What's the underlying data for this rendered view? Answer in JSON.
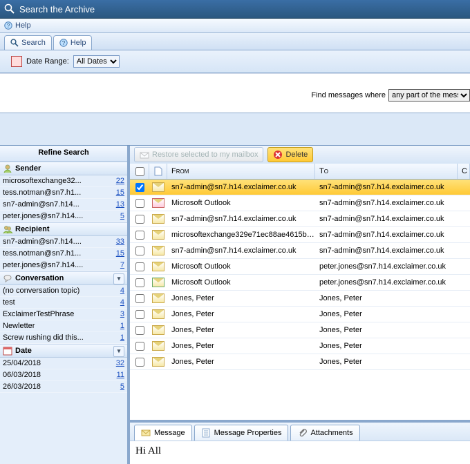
{
  "window": {
    "title": "Search the Archive"
  },
  "menu": {
    "help": "Help"
  },
  "tabs": {
    "search": "Search",
    "help": "Help"
  },
  "dateRange": {
    "label": "Date Range:",
    "options": [
      "All Dates"
    ],
    "selected": "All Dates"
  },
  "find": {
    "label": "Find messages where",
    "options": [
      "any part of the message"
    ],
    "selected": "any part of the message"
  },
  "sidebar": {
    "title": "Refine Search",
    "sections": [
      {
        "name": "Sender",
        "items": [
          {
            "label": "microsoftexchange32...",
            "count": 22
          },
          {
            "label": "tess.notman@sn7.h1...",
            "count": 15
          },
          {
            "label": "sn7-admin@sn7.h14...",
            "count": 13
          },
          {
            "label": "peter.jones@sn7.h14....",
            "count": 5
          }
        ]
      },
      {
        "name": "Recipient",
        "items": [
          {
            "label": "sn7-admin@sn7.h14....",
            "count": 33
          },
          {
            "label": "tess.notman@sn7.h1...",
            "count": 15
          },
          {
            "label": "peter.jones@sn7.h14....",
            "count": 7
          }
        ]
      },
      {
        "name": "Conversation",
        "chevron": true,
        "items": [
          {
            "label": "(no conversation topic)",
            "count": 4
          },
          {
            "label": "test",
            "count": 4
          },
          {
            "label": "ExclaimerTestPhrase",
            "count": 3
          },
          {
            "label": "Newletter",
            "count": 1
          },
          {
            "label": "Screw rushing did this...",
            "count": 1
          }
        ]
      },
      {
        "name": "Date",
        "chevron": true,
        "items": [
          {
            "label": "25/04/2018",
            "count": 32
          },
          {
            "label": "06/03/2018",
            "count": 11
          },
          {
            "label": "26/03/2018",
            "count": 5
          }
        ]
      }
    ]
  },
  "toolbar": {
    "restore": "Restore selected to my mailbox",
    "delete": "Delete"
  },
  "grid": {
    "headers": {
      "from": "From",
      "to": "To",
      "cc": "C"
    },
    "rows": [
      {
        "checked": true,
        "icon": "env",
        "from": "sn7-admin@sn7.h14.exclaimer.co.uk",
        "to": "sn7-admin@sn7.h14.exclaimer.co.uk",
        "selected": true
      },
      {
        "checked": false,
        "icon": "env-red",
        "from": "Microsoft Outlook",
        "to": "sn7-admin@sn7.h14.exclaimer.co.uk"
      },
      {
        "checked": false,
        "icon": "env",
        "from": "sn7-admin@sn7.h14.exclaimer.co.uk",
        "to": "sn7-admin@sn7.h14.exclaimer.co.uk"
      },
      {
        "checked": false,
        "icon": "env",
        "from": "microsoftexchange329e71ec88ae4615bb...",
        "to": "sn7-admin@sn7.h14.exclaimer.co.uk"
      },
      {
        "checked": false,
        "icon": "env",
        "from": "sn7-admin@sn7.h14.exclaimer.co.uk",
        "to": "sn7-admin@sn7.h14.exclaimer.co.uk"
      },
      {
        "checked": false,
        "icon": "env",
        "from": "Microsoft Outlook",
        "to": "peter.jones@sn7.h14.exclaimer.co.uk"
      },
      {
        "checked": false,
        "icon": "env-green",
        "from": "Microsoft Outlook",
        "to": "peter.jones@sn7.h14.exclaimer.co.uk"
      },
      {
        "checked": false,
        "icon": "env",
        "from": "Jones, Peter",
        "to": "Jones, Peter"
      },
      {
        "checked": false,
        "icon": "env",
        "from": "Jones, Peter",
        "to": "Jones, Peter"
      },
      {
        "checked": false,
        "icon": "env",
        "from": "Jones, Peter",
        "to": "Jones, Peter"
      },
      {
        "checked": false,
        "icon": "env",
        "from": "Jones, Peter",
        "to": "Jones, Peter"
      },
      {
        "checked": false,
        "icon": "env",
        "from": "Jones, Peter",
        "to": "Jones, Peter"
      }
    ]
  },
  "detail": {
    "tabs": {
      "message": "Message",
      "properties": "Message Properties",
      "attachments": "Attachments"
    },
    "body_preview": "Hi All"
  }
}
